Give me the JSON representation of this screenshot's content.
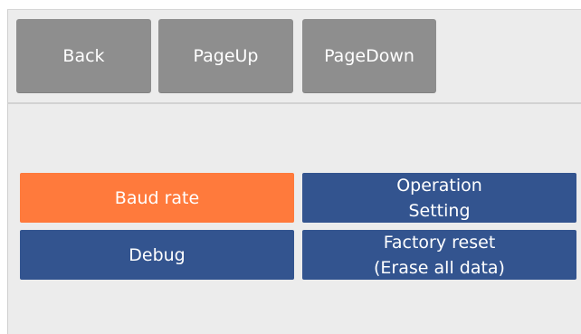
{
  "toolbar": {
    "back_label": "Back",
    "pageup_label": "PageUp",
    "pagedown_label": "PageDown"
  },
  "menu": {
    "baud_rate": {
      "label": "Baud rate",
      "state": "selected"
    },
    "operation_setting": {
      "line1": "Operation",
      "line2": "Setting"
    },
    "debug": {
      "label": "Debug"
    },
    "factory_reset": {
      "line1": "Factory reset",
      "line2": "(Erase all data)"
    }
  },
  "colors": {
    "nav_button": "#8e8e8e",
    "selected": "#ff7a3c",
    "menu_button": "#33548f",
    "background": "#ececec"
  }
}
